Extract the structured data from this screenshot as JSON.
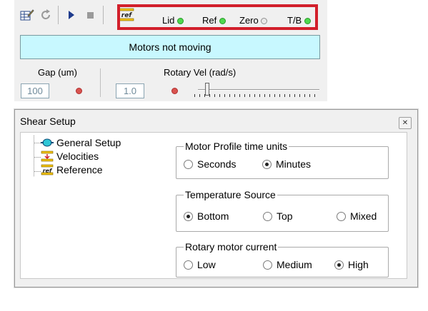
{
  "toolbar": {
    "icons": [
      "edit-table-icon",
      "refresh-icon",
      "play-icon",
      "stop-icon",
      "ref-icon"
    ],
    "indicators": [
      {
        "label": "Lid",
        "state": "green"
      },
      {
        "label": "Ref",
        "state": "green"
      },
      {
        "label": "Zero",
        "state": "grey"
      },
      {
        "label": "T/B",
        "state": "green"
      }
    ]
  },
  "status": {
    "text": "Motors not moving"
  },
  "gap": {
    "label": "Gap (um)",
    "value": "100"
  },
  "rotary": {
    "label": "Rotary Vel (rad/s)",
    "value": "1.0"
  },
  "dialog": {
    "title": "Shear Setup",
    "close_icon": "close-icon",
    "tree": [
      {
        "label": "General Setup",
        "icon": "general-setup-icon"
      },
      {
        "label": "Velocities",
        "icon": "velocities-icon"
      },
      {
        "label": "Reference",
        "icon": "reference-icon"
      }
    ],
    "groups": [
      {
        "title": "Motor Profile time units",
        "options": [
          "Seconds",
          "Minutes"
        ],
        "selected": "Minutes"
      },
      {
        "title": "Temperature Source",
        "options": [
          "Bottom",
          "Top",
          "Mixed"
        ],
        "selected": "Bottom"
      },
      {
        "title": "Rotary motor current",
        "options": [
          "Low",
          "Medium",
          "High"
        ],
        "selected": "High"
      }
    ]
  },
  "colors": {
    "status_bg": "#c8f8ff",
    "highlight": "#d21f2b",
    "led_green": "#4ed84e",
    "led_red": "#d9534f"
  }
}
